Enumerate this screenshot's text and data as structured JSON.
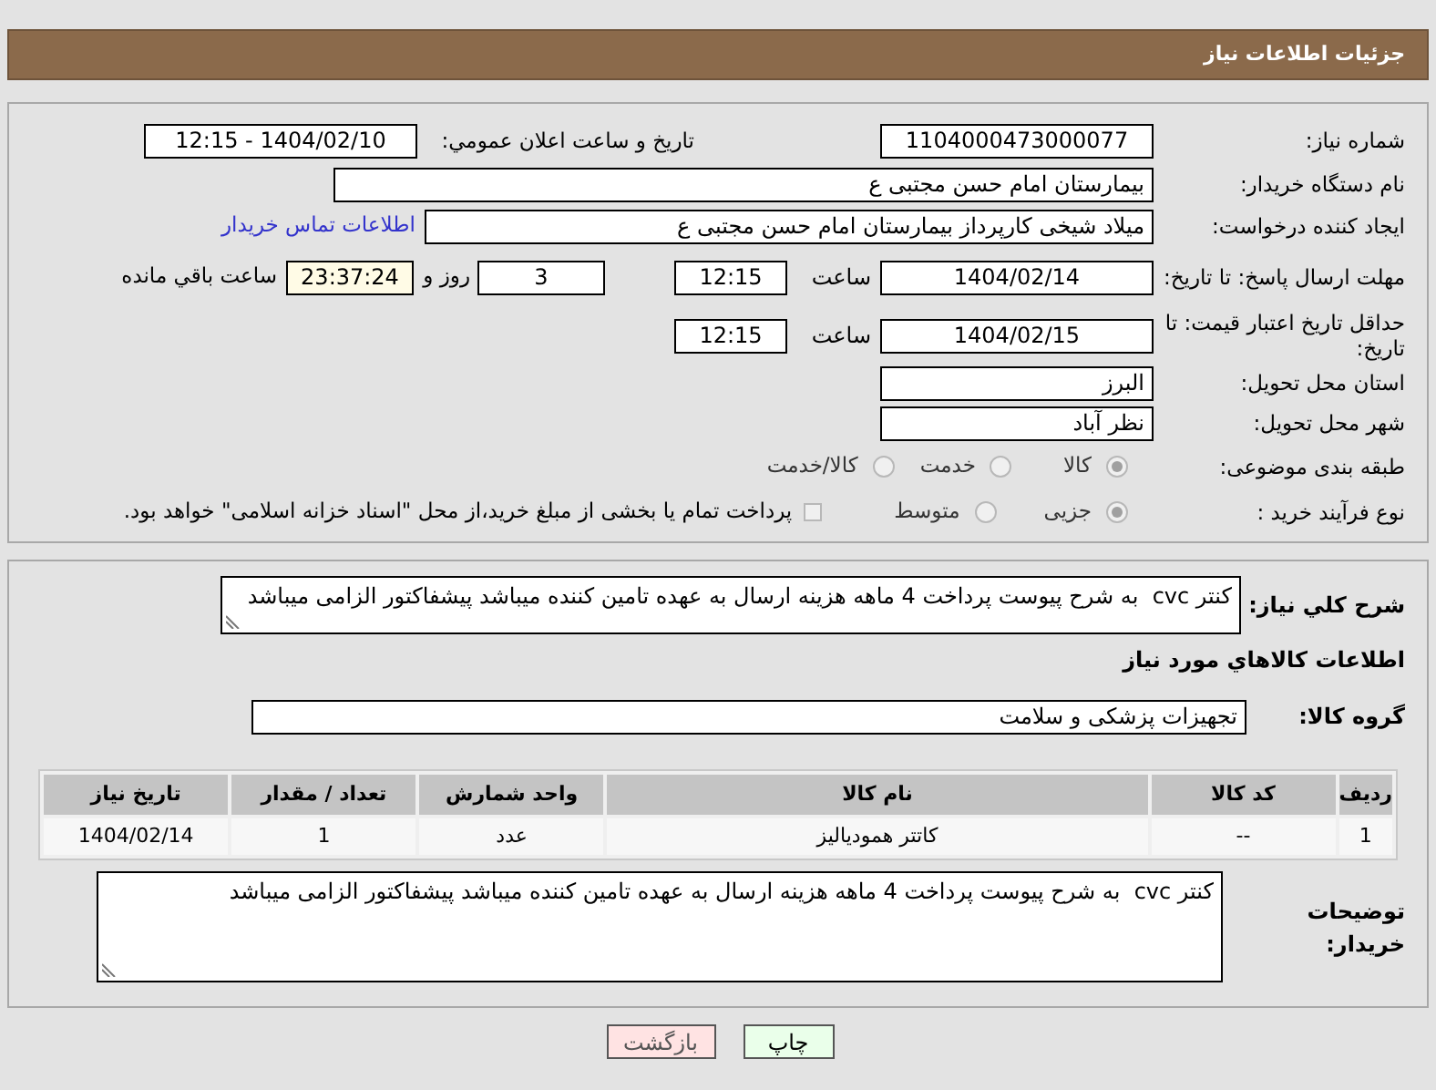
{
  "header": {
    "title": "جزئیات اطلاعات نیاز"
  },
  "need_number": {
    "label": "شماره نیاز:",
    "value": "1104000473000077"
  },
  "announce": {
    "label": "تاریخ و ساعت اعلان عمومي:",
    "value": "1404/02/10 - 12:15"
  },
  "buyer": {
    "label": "نام دستگاه خریدار:",
    "value": "بیمارستان امام حسن مجتبی ع"
  },
  "creator": {
    "label": "ایجاد کننده درخواست:",
    "value": "میلاد شیخی کارپرداز بیمارستان امام حسن مجتبی ع",
    "link": "اطلاعات تماس خریدار"
  },
  "deadline": {
    "label": "مهلت ارسال پاسخ: تا تاریخ:",
    "date": "1404/02/14",
    "time_label": "ساعت",
    "time": "12:15",
    "days": "3",
    "days_label": "روز و",
    "remaining": "23:37:24",
    "remaining_label": "ساعت باقي مانده"
  },
  "validity": {
    "label": "حداقل تاریخ اعتبار قیمت: تا تاریخ:",
    "date": "1404/02/15",
    "time_label": "ساعت",
    "time": "12:15"
  },
  "province": {
    "label": "استان محل تحویل:",
    "value": "البرز"
  },
  "city": {
    "label": "شهر محل تحویل:",
    "value": "نظر آباد"
  },
  "category": {
    "label": "طبقه بندی موضوعی:",
    "options": [
      {
        "label": "کالا",
        "selected": true,
        "disabled": true
      },
      {
        "label": "خدمت",
        "selected": false,
        "disabled": true
      },
      {
        "label": "کالا/خدمت",
        "selected": false,
        "disabled": true
      }
    ]
  },
  "process": {
    "label": "نوع فرآیند خرید :",
    "options": [
      {
        "label": "جزیی",
        "selected": true,
        "disabled": true
      },
      {
        "label": "متوسط",
        "selected": false,
        "disabled": true
      }
    ],
    "checkbox": {
      "label": "پرداخت تمام یا بخشی از مبلغ خرید،از محل \"اسناد خزانه اسلامی\" خواهد بود.",
      "checked": false,
      "disabled": true
    }
  },
  "description": {
    "label": "شرح کلي نیاز:",
    "value": "کنتر cvc  به شرح پیوست پرداخت 4 ماهه هزینه ارسال به عهده تامین کننده میباشد پیشفاکتور الزامی میباشد"
  },
  "goods_title": "اطلاعات کالاهاي مورد نیاز",
  "goods_group": {
    "label": "گروه کالا:",
    "value": "تجهیزات پزشکی و سلامت"
  },
  "table": {
    "columns": [
      "ردیف",
      "کد کالا",
      "نام کالا",
      "واحد شمارش",
      "تعداد / مقدار",
      "تاریخ نیاز"
    ],
    "rows": [
      [
        "1",
        "--",
        "کاتتر همودیالیز",
        "عدد",
        "1",
        "1404/02/14"
      ]
    ]
  },
  "buyer_notes": {
    "label": "توضیحات خریدار:",
    "value": "کنتر cvc  به شرح پیوست پرداخت 4 ماهه هزینه ارسال به عهده تامین کننده میباشد پیشفاکتور الزامی میباشد"
  },
  "buttons": [
    {
      "label": "چاپ",
      "kind": "print"
    },
    {
      "label": "بازگشت",
      "kind": "back"
    }
  ]
}
